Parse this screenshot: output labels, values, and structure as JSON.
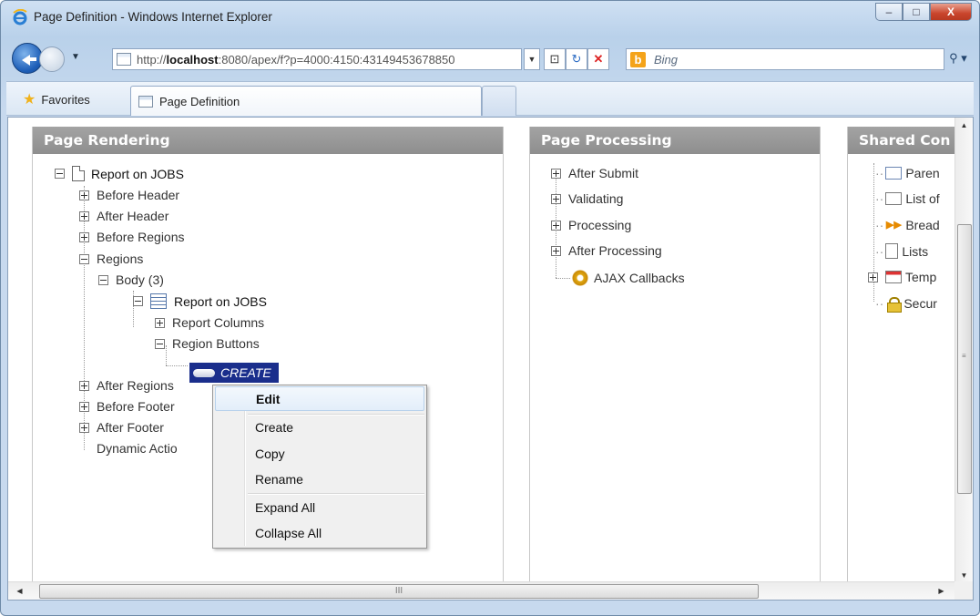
{
  "window": {
    "title": "Page Definition - Windows Internet Explorer",
    "controls": {
      "minimize": "–",
      "maximize": "□",
      "close": "X"
    }
  },
  "address": {
    "url_prefix": "http://",
    "url_host": "localhost",
    "url_rest": ":8080/apex/f?p=4000:4150:43149453678850",
    "search_placeholder": "Bing"
  },
  "favorites": {
    "label": "Favorites",
    "tab_label": "Page Definition"
  },
  "panels": {
    "rendering": {
      "title": "Page Rendering",
      "root": "Report on JOBS",
      "items": {
        "before_header": "Before Header",
        "after_header": "After Header",
        "before_regions": "Before Regions",
        "regions": "Regions",
        "body": "Body (3)",
        "report": "Report on JOBS",
        "report_columns": "Report Columns",
        "region_buttons": "Region Buttons",
        "create_button": "CREATE",
        "after_regions": "After Regions",
        "before_footer": "Before Footer",
        "after_footer": "After Footer",
        "dynamic_actions": "Dynamic Actio"
      }
    },
    "processing": {
      "title": "Page Processing",
      "items": {
        "after_submit": "After Submit",
        "validating": "Validating",
        "processing": "Processing",
        "after_processing": "After Processing",
        "ajax": "AJAX Callbacks"
      }
    },
    "shared": {
      "title": "Shared Con",
      "items": {
        "parent": "Paren",
        "list_of": "List of",
        "bread": "Bread",
        "lists": "Lists",
        "templ": "Temp",
        "secur": "Secur"
      }
    }
  },
  "context_menu": {
    "edit": "Edit",
    "create": "Create",
    "copy": "Copy",
    "rename": "Rename",
    "expand_all": "Expand All",
    "collapse_all": "Collapse All"
  },
  "scrollbar": {
    "grip": "III"
  },
  "colors": {
    "selection": "#1a2e8c",
    "panel_header": "#999999",
    "close_button": "#c9452c"
  }
}
